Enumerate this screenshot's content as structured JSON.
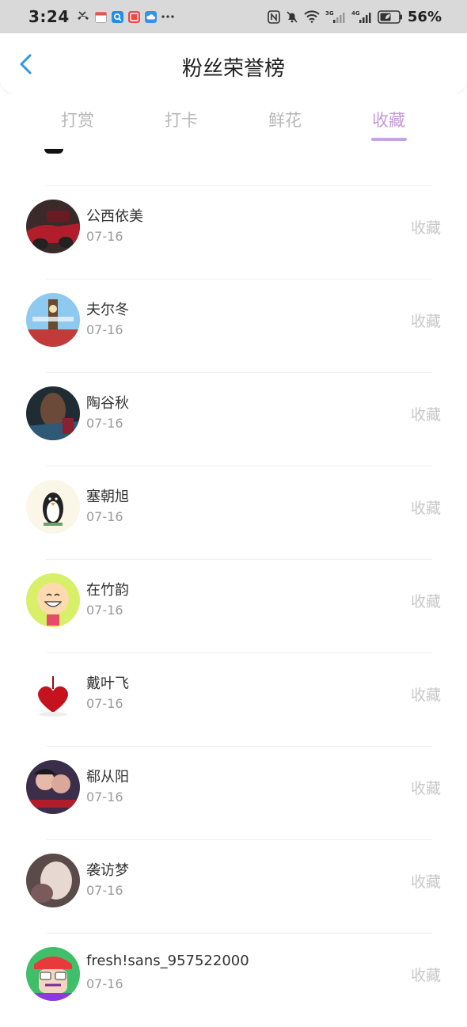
{
  "status_bar": {
    "time": "3:24",
    "net_3g": "3G",
    "net_4g": "4G",
    "battery": "56%"
  },
  "header": {
    "title": "粉丝荣誉榜"
  },
  "tabs": [
    {
      "label": "打赏",
      "active": false
    },
    {
      "label": "打卡",
      "active": false
    },
    {
      "label": "鲜花",
      "active": false
    },
    {
      "label": "收藏",
      "active": true
    }
  ],
  "colors": {
    "accent": "#c29ad8",
    "muted": "#b7b7b7",
    "back": "#2f95e8"
  },
  "fans": [
    {
      "name": "公西依美",
      "date": "07-16",
      "action": "收藏",
      "avatar_icon": "red-car-avatar"
    },
    {
      "name": "夫尔冬",
      "date": "07-16",
      "action": "收藏",
      "avatar_icon": "london-clock-avatar"
    },
    {
      "name": "陶谷秋",
      "date": "07-16",
      "action": "收藏",
      "avatar_icon": "dark-photo-avatar"
    },
    {
      "name": "塞朝旭",
      "date": "07-16",
      "action": "收藏",
      "avatar_icon": "penguin-avatar"
    },
    {
      "name": "在竹韵",
      "date": "07-16",
      "action": "收藏",
      "avatar_icon": "smiley-cartoon-avatar"
    },
    {
      "name": "戴叶飞",
      "date": "07-16",
      "action": "收藏",
      "avatar_icon": "red-heart-avatar"
    },
    {
      "name": "郗从阳",
      "date": "07-16",
      "action": "收藏",
      "avatar_icon": "couple-photo-avatar"
    },
    {
      "name": "袭访梦",
      "date": "07-16",
      "action": "收藏",
      "avatar_icon": "soft-photo-avatar"
    },
    {
      "name": "fresh!sans_957522000",
      "date": "07-16",
      "action": "收藏",
      "avatar_icon": "cartoon-character-avatar"
    }
  ]
}
